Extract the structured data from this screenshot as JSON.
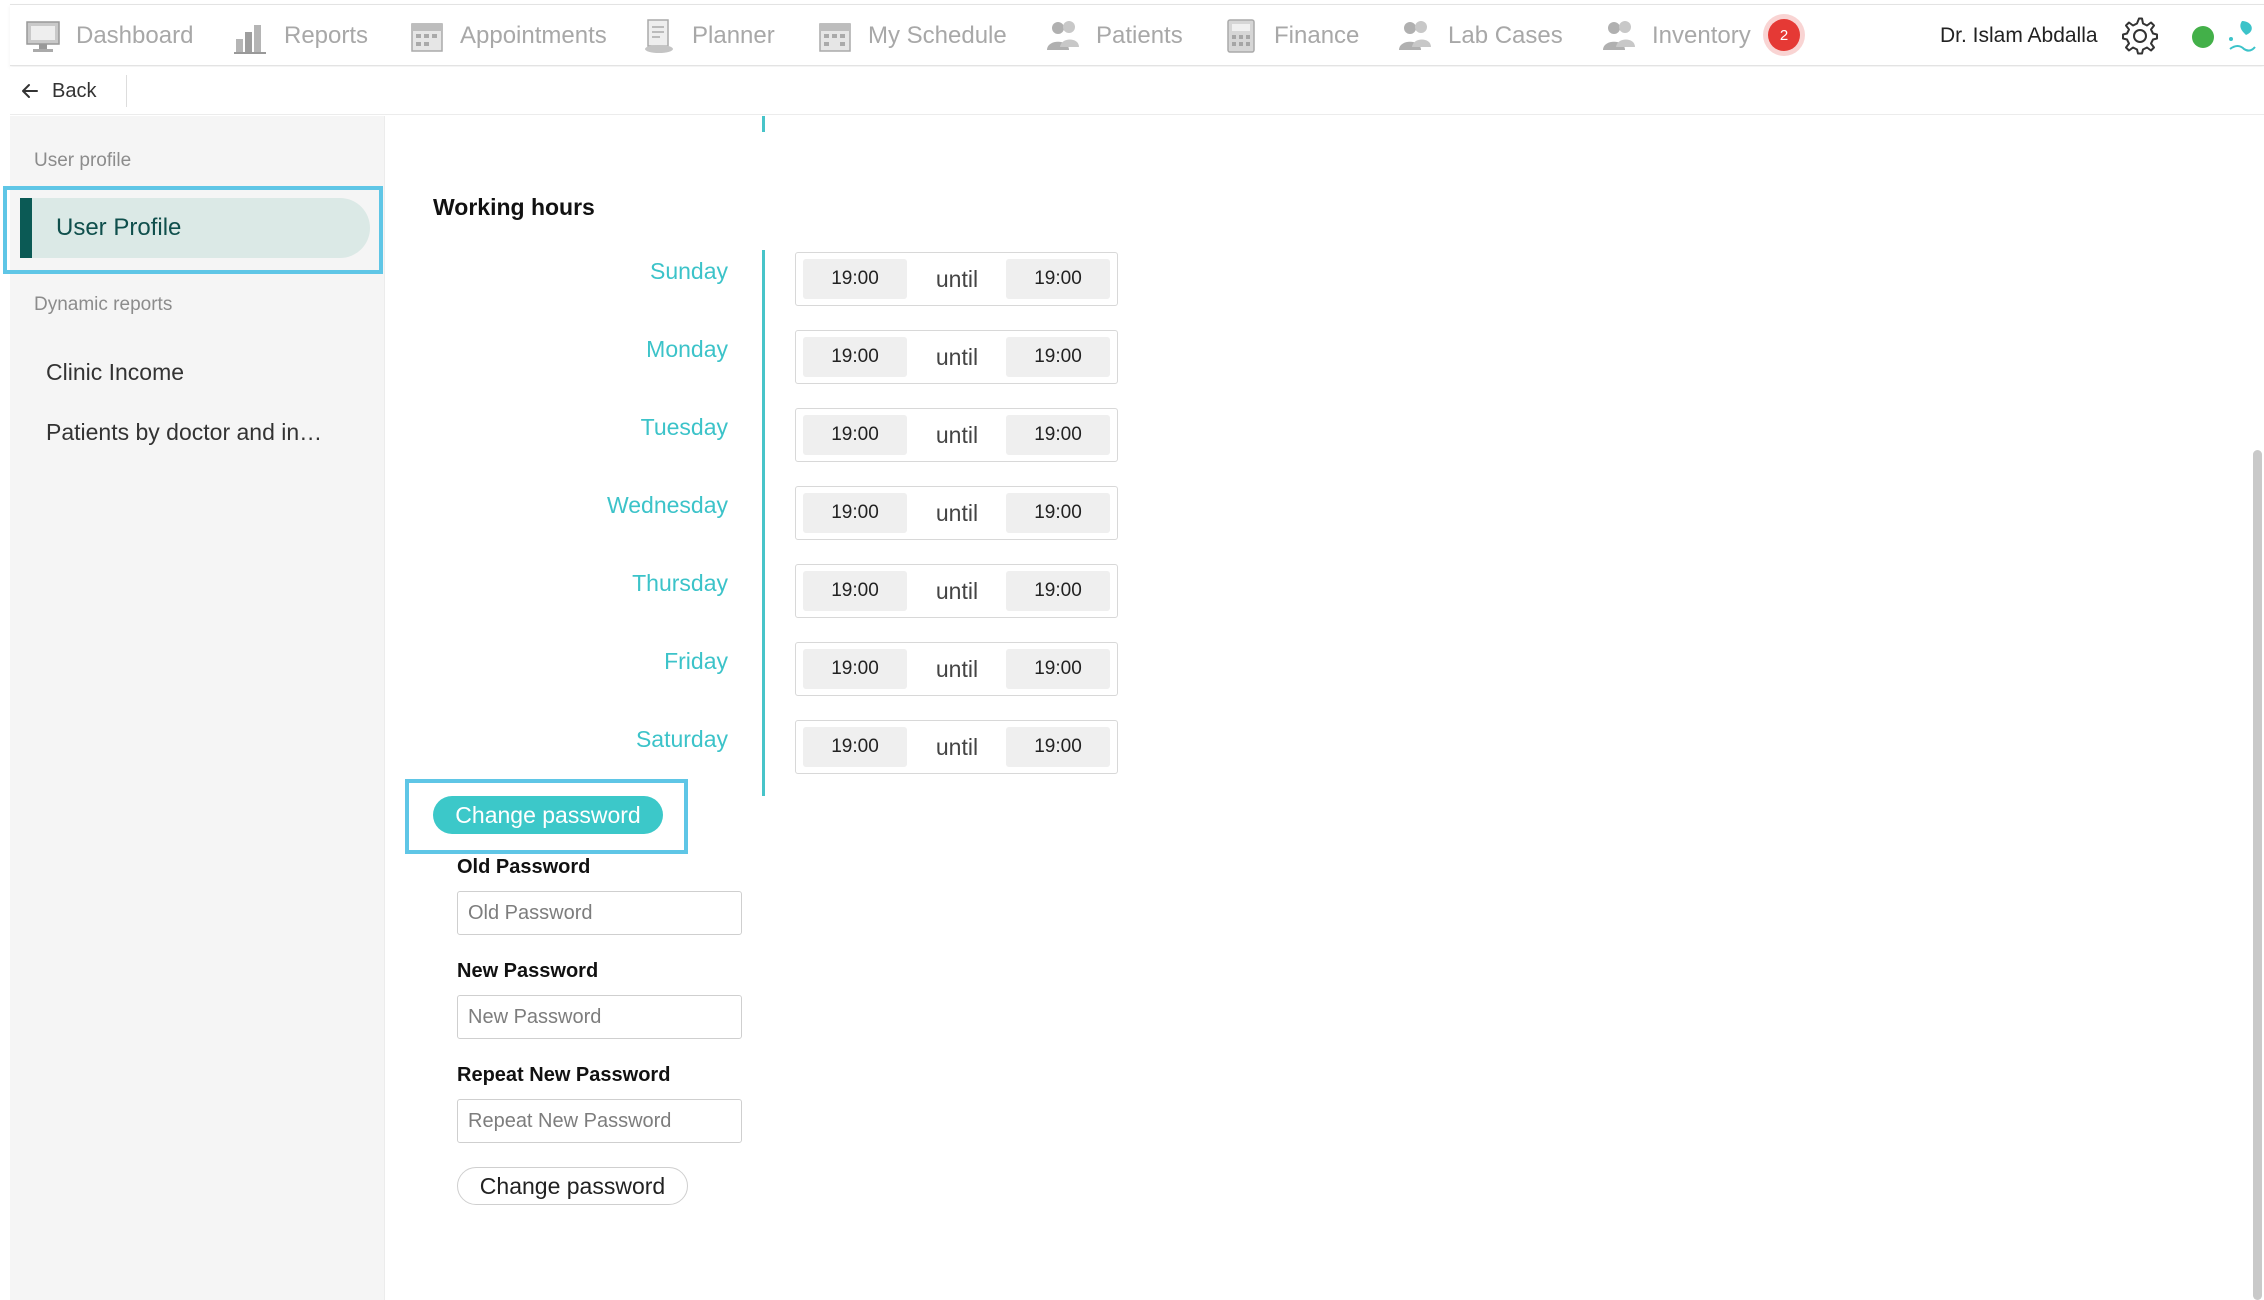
{
  "nav": {
    "items": [
      {
        "label": "Dashboard",
        "icon": "dashboard-icon"
      },
      {
        "label": "Reports",
        "icon": "reports-icon"
      },
      {
        "label": "Appointments",
        "icon": "appointments-icon"
      },
      {
        "label": "Planner",
        "icon": "planner-icon"
      },
      {
        "label": "My Schedule",
        "icon": "schedule-icon"
      },
      {
        "label": "Patients",
        "icon": "patients-icon"
      },
      {
        "label": "Finance",
        "icon": "finance-icon"
      },
      {
        "label": "Lab Cases",
        "icon": "lab-cases-icon"
      },
      {
        "label": "Inventory",
        "icon": "inventory-icon"
      }
    ],
    "notification_count": "2",
    "user_name": "Dr. Islam Abdalla",
    "status_color": "#43b049"
  },
  "backbar": {
    "back_label": "Back"
  },
  "sidebar": {
    "group1": "User profile",
    "active_item": "User Profile",
    "group2": "Dynamic reports",
    "items": [
      "Clinic Income",
      "Patients by doctor and in…"
    ]
  },
  "working_hours": {
    "title": "Working hours",
    "until_label": "until",
    "days": [
      {
        "day": "Sunday",
        "from": "19:00",
        "to": "19:00"
      },
      {
        "day": "Monday",
        "from": "19:00",
        "to": "19:00"
      },
      {
        "day": "Tuesday",
        "from": "19:00",
        "to": "19:00"
      },
      {
        "day": "Wednesday",
        "from": "19:00",
        "to": "19:00"
      },
      {
        "day": "Thursday",
        "from": "19:00",
        "to": "19:00"
      },
      {
        "day": "Friday",
        "from": "19:00",
        "to": "19:00"
      },
      {
        "day": "Saturday",
        "from": "19:00",
        "to": "19:00"
      }
    ]
  },
  "password": {
    "toggle_label": "Change password",
    "old_label": "Old Password",
    "old_placeholder": "Old Password",
    "new_label": "New Password",
    "new_placeholder": "New Password",
    "repeat_label": "Repeat New Password",
    "repeat_placeholder": "Repeat New Password",
    "submit_label": "Change password"
  },
  "colors": {
    "accent": "#3cc3c9",
    "highlight_frame": "#5fc6e6",
    "badge": "#e53935"
  }
}
